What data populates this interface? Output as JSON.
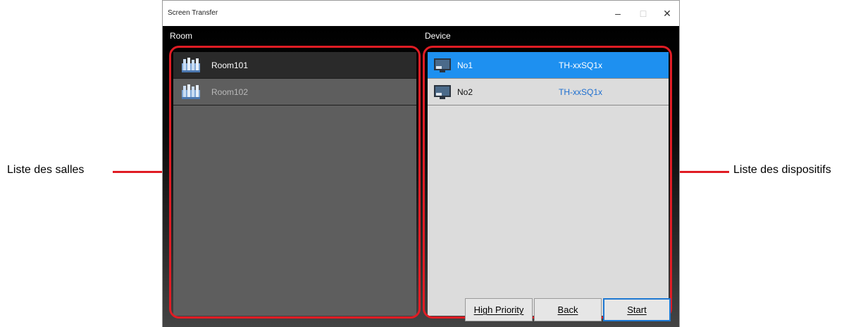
{
  "window": {
    "title": "Screen Transfer",
    "min_glyph": "–",
    "max_glyph": "□",
    "close_glyph": "✕"
  },
  "sections": {
    "room_label": "Room",
    "device_label": "Device"
  },
  "rooms": [
    {
      "label": "Room101",
      "selected": true,
      "icon": "room-icon"
    },
    {
      "label": "Room102",
      "selected": false,
      "icon": "room-icon"
    }
  ],
  "devices": [
    {
      "name": "No1",
      "model": "TH-xxSQ1x",
      "selected": true,
      "icon": "display-icon"
    },
    {
      "name": "No2",
      "model": "TH-xxSQ1x",
      "selected": false,
      "icon": "display-icon"
    }
  ],
  "buttons": {
    "high_priority": "High Priority",
    "back": "Back",
    "start": "Start"
  },
  "callouts": {
    "rooms": "Liste des salles",
    "devices": "Liste des dispositifs"
  },
  "colors": {
    "highlight": "#e01c24",
    "selected_device": "#1e90f0",
    "model_text": "#1e6fd0"
  }
}
